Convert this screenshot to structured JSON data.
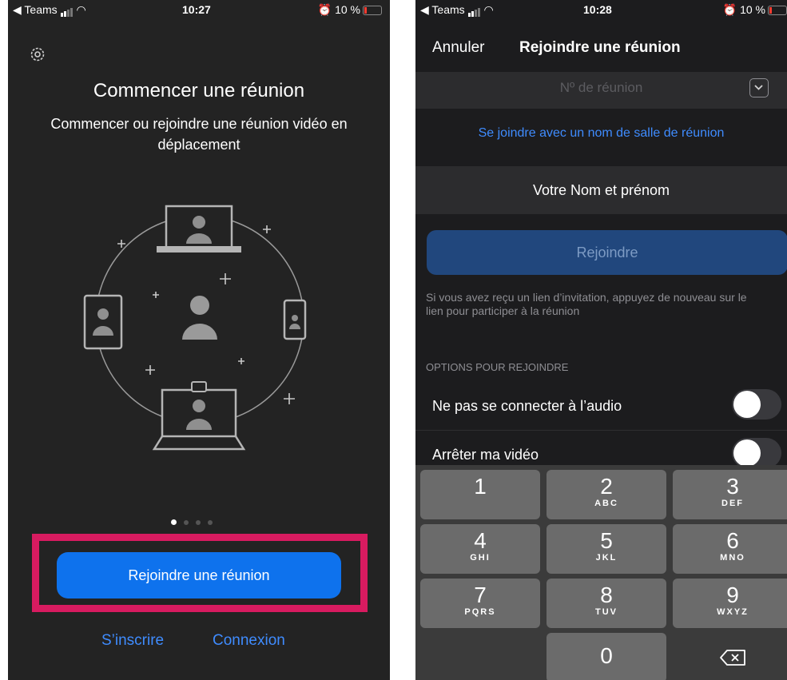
{
  "left": {
    "status": {
      "carrier": "◀ Teams",
      "time": "10:27",
      "battery": "10 %"
    },
    "settings_icon": "gear-icon",
    "title": "Commencer une réunion",
    "subtitle": "Commencer ou rejoindre une réunion vidéo en déplacement",
    "page_dots": 4,
    "active_dot": 1,
    "join_button": "Rejoindre une réunion",
    "signup_link": "S’inscrire",
    "login_link": "Connexion",
    "highlight_color": "#d81b60",
    "accent": "#0e72ed"
  },
  "right": {
    "status": {
      "carrier": "◀ Teams",
      "time": "10:28",
      "battery": "10 %"
    },
    "cancel": "Annuler",
    "title": "Rejoindre une réunion",
    "meeting_id_placeholder": "Nº de réunion",
    "room_link": "Se joindre avec un nom de salle de réunion",
    "name_field": "Votre Nom et prénom",
    "join_button": "Rejoindre",
    "invite_hint": "Si vous avez reçu un lien d’invitation, appuyez de nouveau sur le lien pour participer à la réunion",
    "options_header": "OPTIONS POUR REJOINDRE",
    "options": [
      {
        "label": "Ne pas se connecter à l’audio",
        "on": false
      },
      {
        "label": "Arrêter ma vidéo",
        "on": false
      }
    ],
    "keypad": [
      {
        "n": "1",
        "l": ""
      },
      {
        "n": "2",
        "l": "ABC"
      },
      {
        "n": "3",
        "l": "DEF"
      },
      {
        "n": "4",
        "l": "GHI"
      },
      {
        "n": "5",
        "l": "JKL"
      },
      {
        "n": "6",
        "l": "MNO"
      },
      {
        "n": "7",
        "l": "PQRS"
      },
      {
        "n": "8",
        "l": "TUV"
      },
      {
        "n": "9",
        "l": "WXYZ"
      },
      {
        "n": "0",
        "l": ""
      }
    ],
    "backspace_icon": "backspace-icon"
  }
}
